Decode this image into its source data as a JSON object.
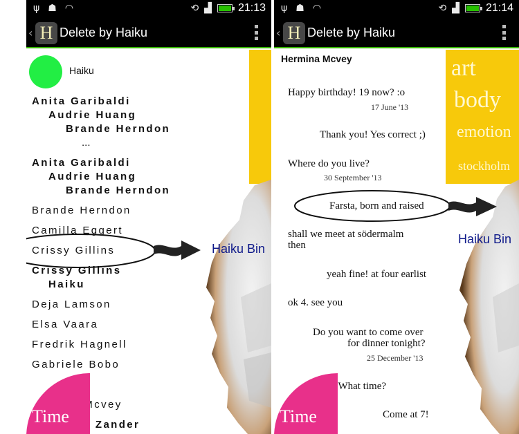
{
  "left": {
    "statusbar": {
      "time": "21:13"
    },
    "actionbar": {
      "icon_letter": "H",
      "title": "Delete by Haiku"
    },
    "header_label": "Haiku",
    "names": [
      {
        "text": "Anita Garibaldi",
        "bold": true
      },
      {
        "text": "Audrie Huang",
        "bold": true
      },
      {
        "text": "Brande Herndon",
        "bold": true
      },
      {
        "text": "...",
        "bold": false
      },
      {
        "text": "Anita Garibaldi",
        "bold": true
      },
      {
        "text": "Audrie Huang",
        "bold": true
      },
      {
        "text": "Brande Herndon",
        "bold": true
      },
      {
        "text": "Brande Herndon",
        "bold": false
      },
      {
        "text": "Camilla Eggert",
        "bold": false
      },
      {
        "text": "Crissy Gillins",
        "bold": false
      },
      {
        "text": "Crissy Gillins",
        "bold": true
      },
      {
        "text": "Haiku",
        "bold": true
      },
      {
        "text": "Deja Lamson",
        "bold": false
      },
      {
        "text": "Elsa Vaara",
        "bold": false
      },
      {
        "text": "Fredrik Hagnell",
        "bold": false
      },
      {
        "text": "Gabriele Bobo",
        "bold": false
      },
      {
        "text": "a Mcvey",
        "bold": false
      },
      {
        "text": "el Zander",
        "bold": true
      }
    ],
    "time_label": "Time",
    "bin_label": "Haiku Bin"
  },
  "right": {
    "statusbar": {
      "time": "21:14"
    },
    "actionbar": {
      "icon_letter": "H",
      "title": "Delete by Haiku"
    },
    "contact": "Hermina Mcvey",
    "messages": [
      {
        "text": "Happy birthday! 19 now? :o",
        "date": "17 June '13"
      },
      {
        "text": "Thank you! Yes correct ;)",
        "date": ""
      },
      {
        "text": "Where do you live?",
        "date": "30 September '13"
      },
      {
        "text": "Farsta, born and raised",
        "date": ""
      },
      {
        "text": "shall we meet at södermalm",
        "text2": "then",
        "date": ""
      },
      {
        "text": "yeah fine! at four earlist",
        "date": ""
      },
      {
        "text": "ok 4. see you",
        "date": ""
      },
      {
        "text": "Do you want to come over",
        "text2": "for dinner tonight?",
        "date": "25 December '13"
      },
      {
        "text": "lease! What time?",
        "date": ""
      },
      {
        "text": "Come at 7!",
        "date": ""
      }
    ],
    "tags": [
      "art",
      "body",
      "emotion",
      "stockholm"
    ],
    "time_label": "Time",
    "bin_label": "Haiku Bin"
  },
  "colors": {
    "accent_green": "#37b600",
    "yellow": "#f7c90b",
    "pink": "#e8308a",
    "bin_blue": "#0f1a8a",
    "dot_green": "#22ee44"
  },
  "icons": {
    "statusbar_left": [
      "usb-icon",
      "android-debug-icon",
      "wifi-icon"
    ],
    "statusbar_right": [
      "rotate-icon",
      "no-signal-icon",
      "battery-icon"
    ]
  }
}
